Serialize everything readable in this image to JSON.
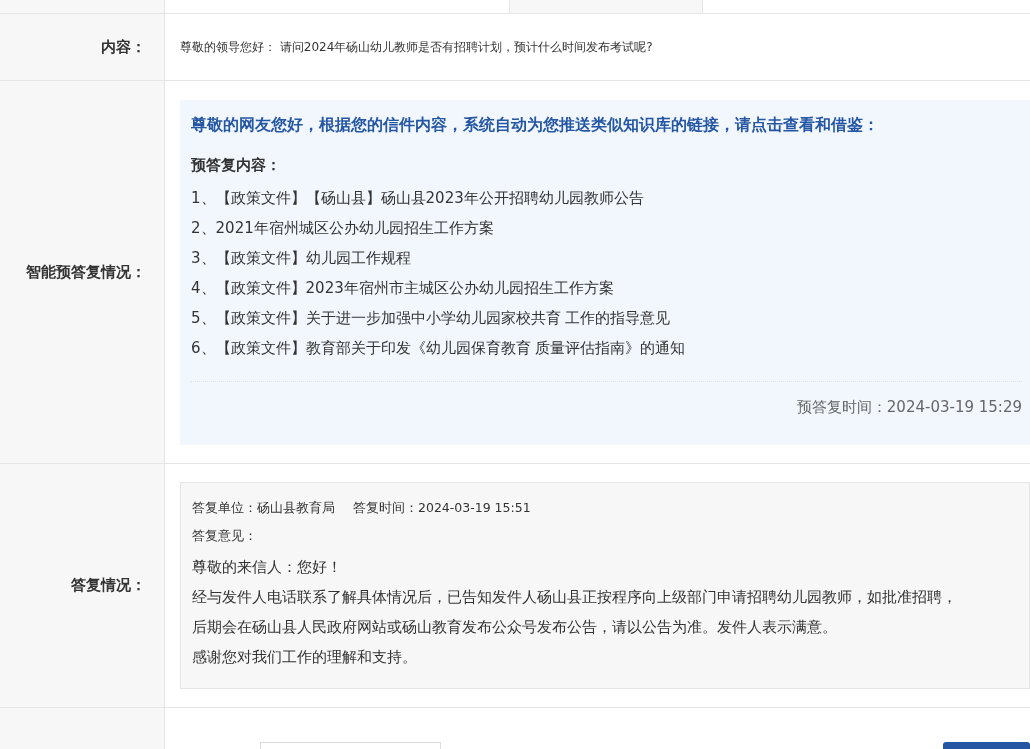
{
  "content_row": {
    "label": "内容：",
    "text": "尊敬的领导您好： 请问2024年砀山幼儿教师是否有招聘计划，预计什么时间发布考试呢?"
  },
  "smart_reply_row": {
    "label": "智能预答复情况：",
    "intro": "尊敬的网友您好，根据您的信件内容，系统自动为您推送类似知识库的链接，请点击查看和借鉴：",
    "subtitle": "预答复内容：",
    "links": [
      "1、【政策文件】【砀山县】砀山县2023年公开招聘幼儿园教师公告",
      "2、2021年宿州城区公办幼儿园招生工作方案",
      "3、【政策文件】幼儿园工作规程",
      "4、【政策文件】2023年宿州市主城区公办幼儿园招生工作方案",
      "5、【政策文件】关于进一步加强中小学幼儿园家校共育 工作的指导意见",
      "6、【政策文件】教育部关于印发《幼儿园保育教育 质量评估指南》的通知"
    ],
    "time": "预答复时间：2024-03-19 15:29"
  },
  "reply_row": {
    "label": "答复情况：",
    "unit": "答复单位：砀山县教育局",
    "time": "答复时间：2024-03-19 15:51",
    "opinion_label": "答复意见：",
    "lines": [
      "尊敬的来信人：您好！",
      "经与发件人电话联系了解具体情况后，已告知发件人砀山县正按程序向上级部门申请招聘幼儿园教师，如批准招聘，",
      "后期会在砀山县人民政府网站或砀山教育发布公众号发布公告，请以公告为准。发件人表示满意。",
      "感谢您对我们工作的理解和支持。"
    ]
  }
}
